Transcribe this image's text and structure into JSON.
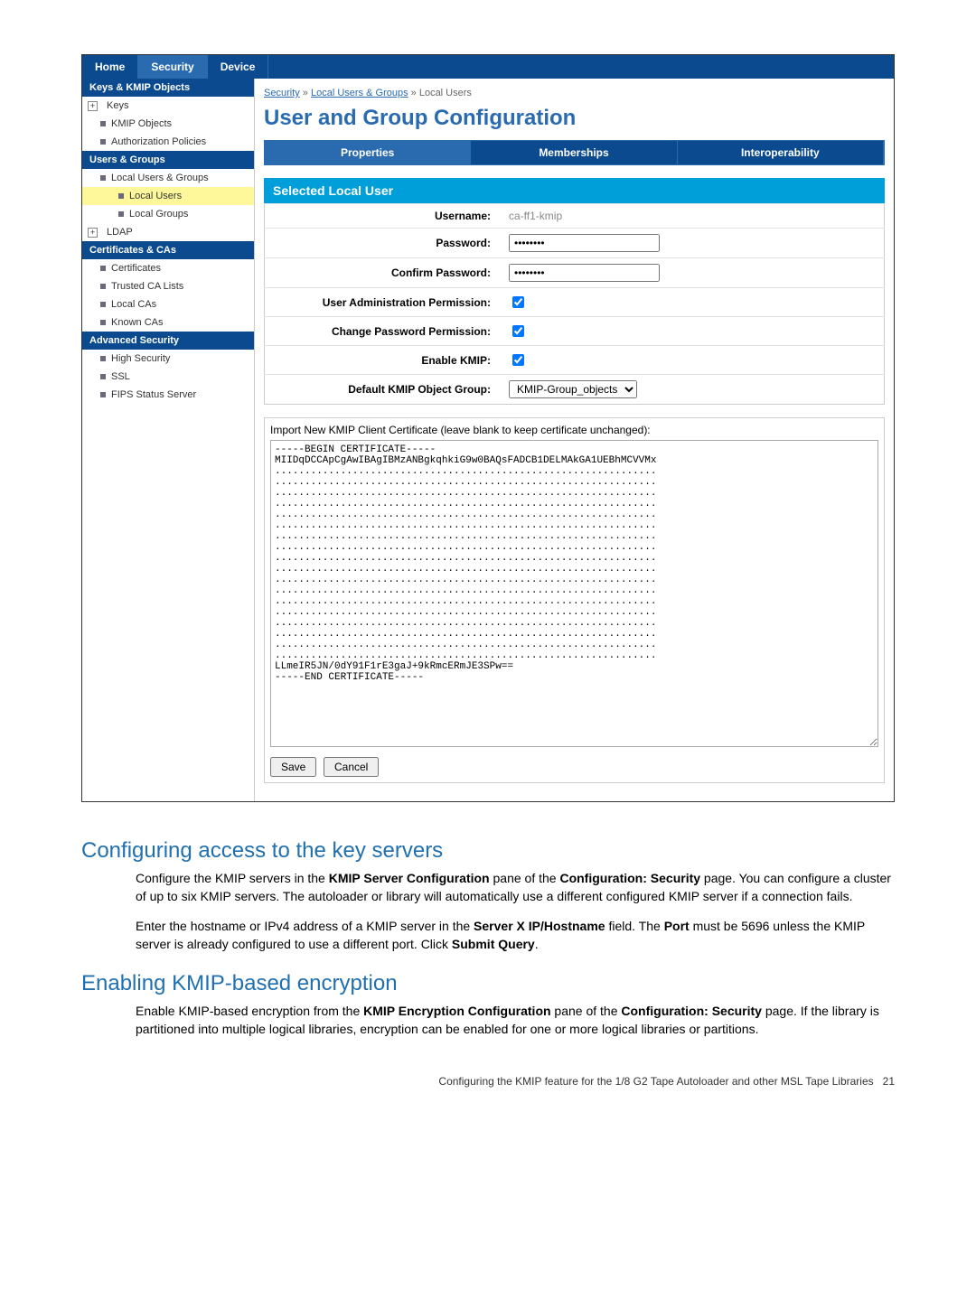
{
  "top_tabs": {
    "home": "Home",
    "security": "Security",
    "device": "Device"
  },
  "sidebar": {
    "keys_hdr": "Keys & KMIP Objects",
    "keys": "Keys",
    "kmip_objects": "KMIP Objects",
    "auth_policies": "Authorization Policies",
    "users_hdr": "Users & Groups",
    "local_ug": "Local Users & Groups",
    "local_users": "Local Users",
    "local_groups": "Local Groups",
    "ldap": "LDAP",
    "certs_hdr": "Certificates & CAs",
    "certs": "Certificates",
    "trusted_ca": "Trusted CA Lists",
    "local_cas": "Local CAs",
    "known_cas": "Known CAs",
    "adv_hdr": "Advanced Security",
    "high_sec": "High Security",
    "ssl": "SSL",
    "fips": "FIPS Status Server"
  },
  "breadcrumb": {
    "a": "Security",
    "sep": " » ",
    "b": "Local Users & Groups",
    "c": "Local Users"
  },
  "page_title": "User and Group Configuration",
  "tabs": {
    "properties": "Properties",
    "memberships": "Memberships",
    "interop": "Interoperability"
  },
  "panel_title": "Selected Local User",
  "form": {
    "username_lbl": "Username:",
    "username_val": "ca-ff1-kmip",
    "password_lbl": "Password:",
    "password_val": "••••••••",
    "confirm_lbl": "Confirm Password:",
    "confirm_val": "••••••••",
    "useradmin_lbl": "User Administration Permission:",
    "chpw_lbl": "Change Password Permission:",
    "enable_kmip_lbl": "Enable KMIP:",
    "default_group_lbl": "Default KMIP Object Group:",
    "default_group_val": "KMIP-Group_objects"
  },
  "cert": {
    "caption": "Import New KMIP Client Certificate (leave blank to keep certificate unchanged):",
    "text": "-----BEGIN CERTIFICATE-----\nMIIDqDCCApCgAwIBAgIBMzANBgkqhkiG9w0BAQsFADCB1DELMAkGA1UEBhMCVVMx\n................................................................\n................................................................\n................................................................\n................................................................\n................................................................\n................................................................\n................................................................\n................................................................\n................................................................\n................................................................\n................................................................\n................................................................\n................................................................\n................................................................\n................................................................\n................................................................\n................................................................\n................................................................\nLLmeIR5JN/0dY91F1rE3gaJ+9kRmcERmJE3SPw==\n-----END CERTIFICATE-----"
  },
  "buttons": {
    "save": "Save",
    "cancel": "Cancel"
  },
  "doc": {
    "h2a": "Configuring access to the key servers",
    "p1a": "Configure the KMIP servers in the ",
    "p1b": "KMIP Server Configuration",
    "p1c": " pane of the ",
    "p1d": "Configuration: Security",
    "p1e": " page. You can configure a cluster of up to six KMIP servers. The autoloader or library will automatically use a different configured KMIP server if a connection fails.",
    "p2a": "Enter the hostname or IPv4 address of a KMIP server in the ",
    "p2b": "Server X IP/Hostname",
    "p2c": " field. The ",
    "p2d": "Port",
    "p2e": " must be 5696 unless the KMIP server is already configured to use a different port. Click ",
    "p2f": "Submit Query",
    "p2g": ".",
    "h2b": "Enabling KMIP-based encryption",
    "p3a": "Enable KMIP-based encryption from the ",
    "p3b": "KMIP Encryption Configuration",
    "p3c": " pane of the ",
    "p3d": "Configuration: Security",
    "p3e": " page. If the library is partitioned into multiple logical libraries, encryption can be enabled for one or more logical libraries or partitions."
  },
  "footer": {
    "text": "Configuring the KMIP feature for the 1/8 G2 Tape Autoloader and other MSL Tape Libraries",
    "pageno": "21"
  }
}
